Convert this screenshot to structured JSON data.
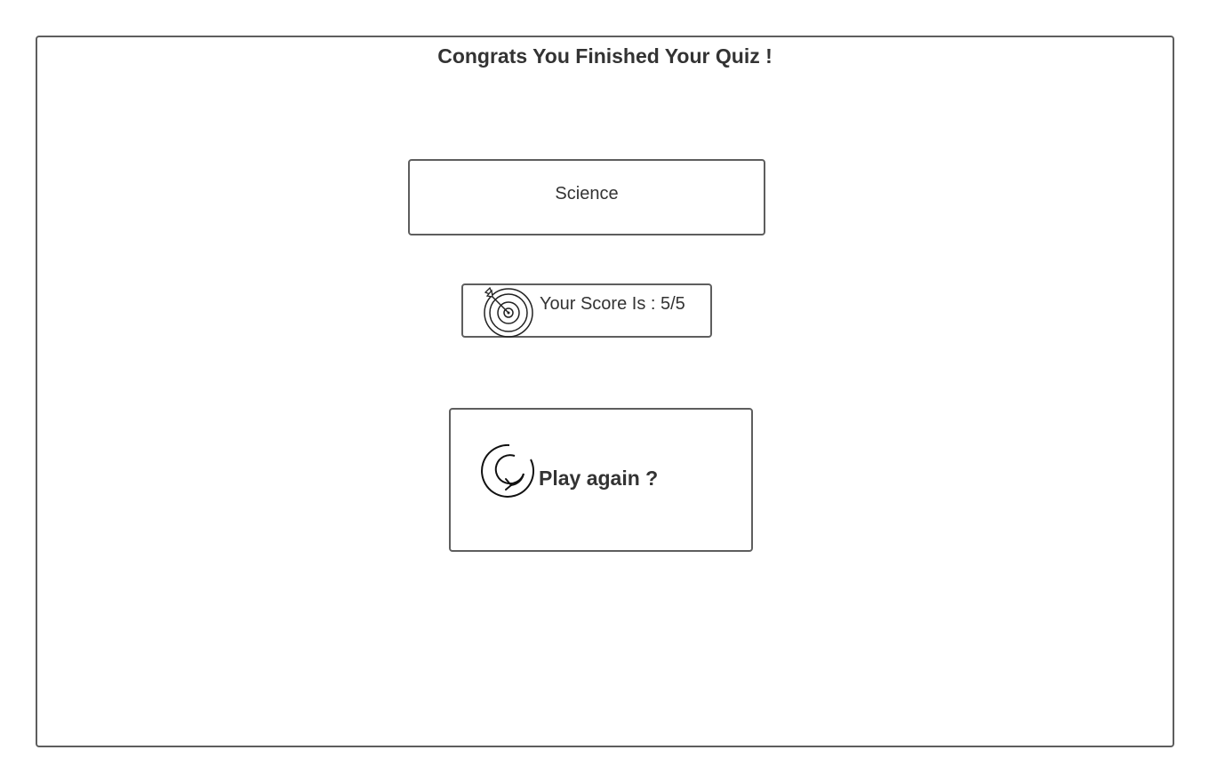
{
  "header": {
    "title": "Congrats You Finished Your Quiz !"
  },
  "result": {
    "category": "Science",
    "score_text": "Your Score Is : 5/5",
    "score_icon": "target-icon"
  },
  "actions": {
    "play_again_label": "Play again ?",
    "play_again_icon": "replay-icon"
  },
  "colors": {
    "border": "#5e5e5e",
    "text": "#333333",
    "background": "#ffffff"
  }
}
